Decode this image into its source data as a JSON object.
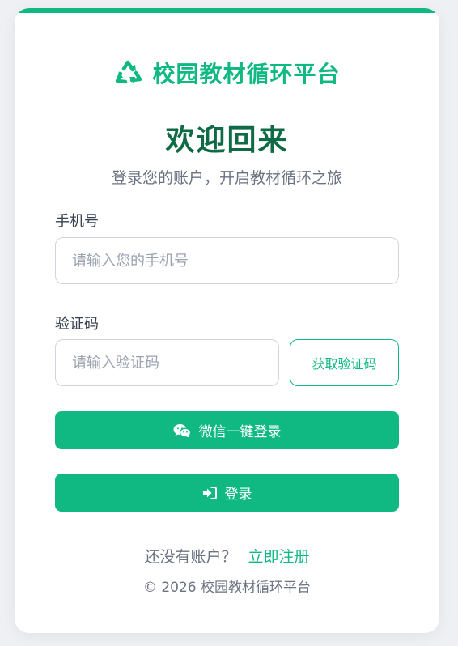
{
  "brand": {
    "name": "校园教材循环平台",
    "icon": "recycle-icon",
    "color": "#10b981"
  },
  "header": {
    "title": "欢迎回来",
    "subtitle": "登录您的账户，开启教材循环之旅"
  },
  "form": {
    "phone_label": "手机号",
    "phone_placeholder": "请输入您的手机号",
    "phone_value": "",
    "code_label": "验证码",
    "code_placeholder": "请输入验证码",
    "code_value": "",
    "get_code_label": "获取验证码"
  },
  "buttons": {
    "wechat_label": "微信一键登录",
    "wechat_icon": "wechat-icon",
    "login_label": "登录",
    "login_icon": "sign-in-icon"
  },
  "register": {
    "question": "还没有账户？",
    "link_label": "立即注册"
  },
  "footer": {
    "copyright": "© 2026 校园教材循环平台"
  },
  "colors": {
    "accent": "#10b981",
    "title": "#0f6b45",
    "muted": "#6b7280",
    "background": "#eef0f3"
  }
}
